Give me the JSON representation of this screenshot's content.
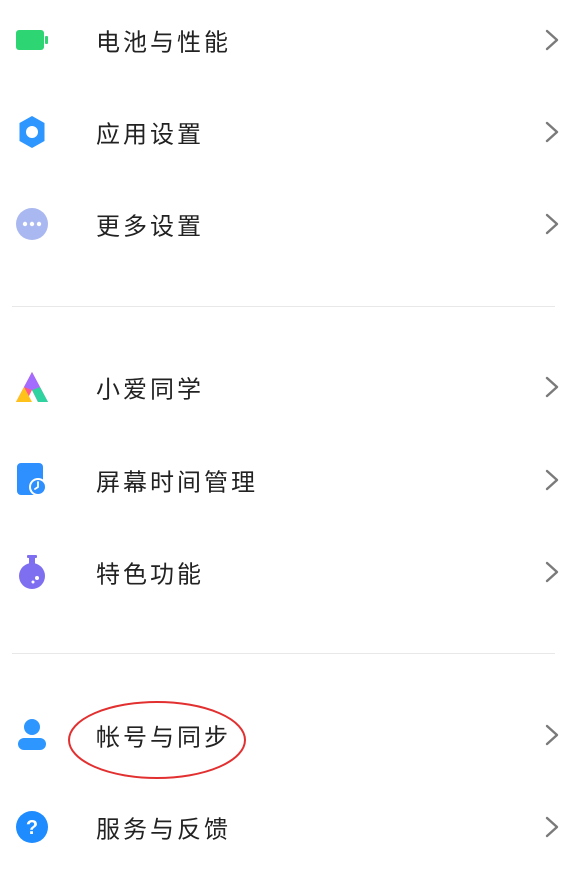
{
  "groups": [
    {
      "items": [
        {
          "label": "电池与性能",
          "icon": "battery-icon"
        },
        {
          "label": "应用设置",
          "icon": "gear-icon"
        },
        {
          "label": "更多设置",
          "icon": "more-dots-icon"
        }
      ]
    },
    {
      "items": [
        {
          "label": "小爱同学",
          "icon": "xiaoai-icon"
        },
        {
          "label": "屏幕时间管理",
          "icon": "screen-time-icon"
        },
        {
          "label": "特色功能",
          "icon": "flask-icon"
        }
      ]
    },
    {
      "items": [
        {
          "label": "帐号与同步",
          "icon": "account-icon"
        },
        {
          "label": "服务与反馈",
          "icon": "help-icon"
        }
      ]
    }
  ],
  "colors": {
    "battery": "#2ed573",
    "gear": "#2e96ff",
    "more": "#a9b8f0",
    "clock": "#2e8fff",
    "flask": "#7d6ff0",
    "account": "#2e96ff",
    "help": "#1e8cff",
    "annotation": "#e23030"
  }
}
